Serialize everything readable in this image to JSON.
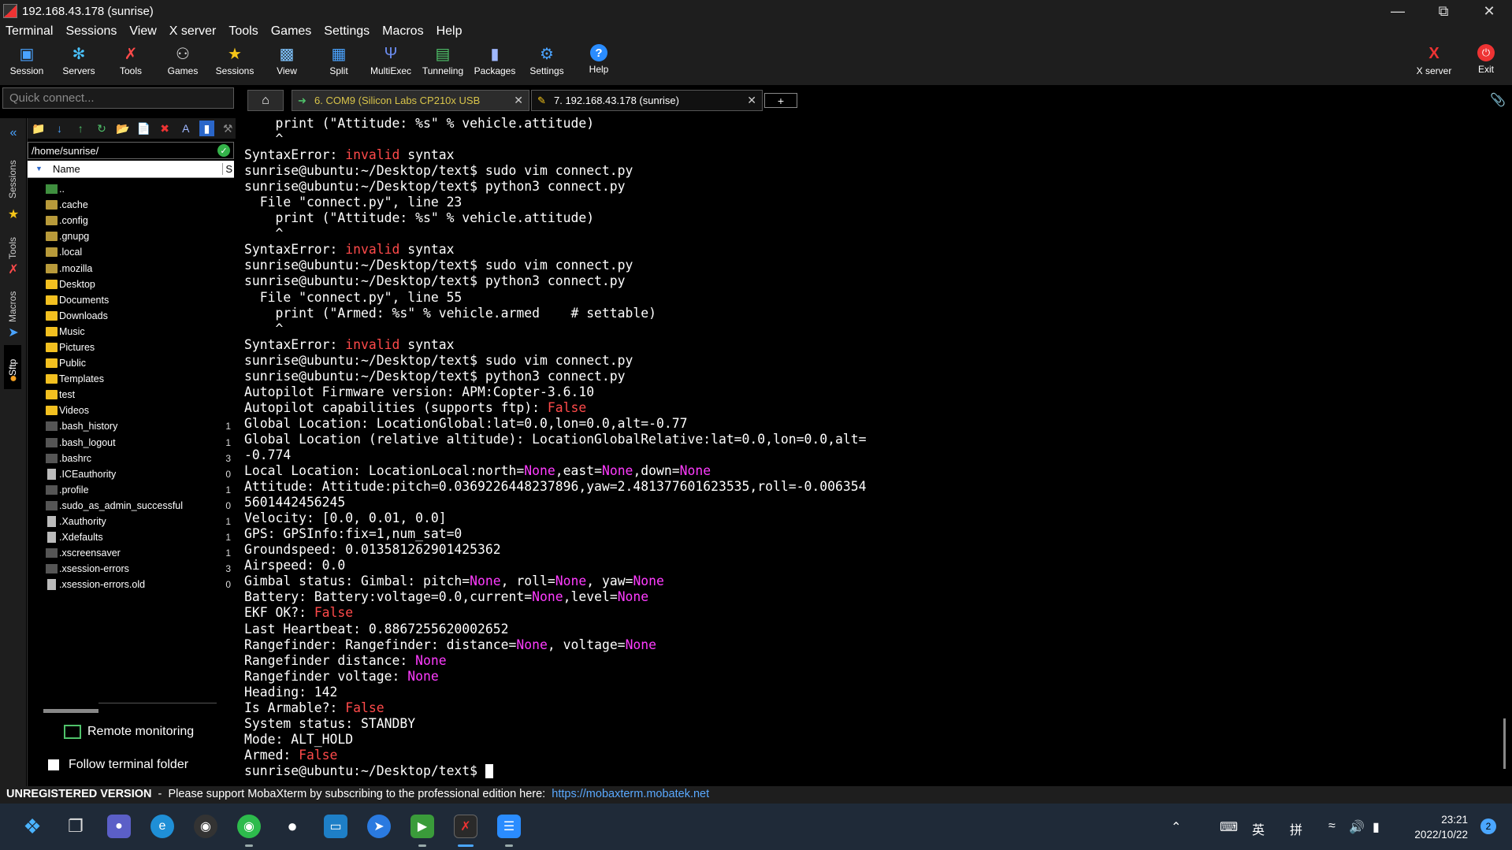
{
  "window": {
    "title": "192.168.43.178 (sunrise)"
  },
  "menu": [
    "Terminal",
    "Sessions",
    "View",
    "X server",
    "Tools",
    "Games",
    "Settings",
    "Macros",
    "Help"
  ],
  "toolbar": {
    "session": "Session",
    "servers": "Servers",
    "tools": "Tools",
    "games": "Games",
    "sessions": "Sessions",
    "view": "View",
    "split": "Split",
    "multiexec": "MultiExec",
    "tunneling": "Tunneling",
    "packages": "Packages",
    "settings": "Settings",
    "help": "Help",
    "xserver": "X server",
    "exit": "Exit"
  },
  "quick_connect": {
    "placeholder": "Quick connect..."
  },
  "tabs": [
    {
      "label": "6. COM9  (Silicon Labs CP210x USB"
    },
    {
      "label": "7. 192.168.43.178 (sunrise)"
    }
  ],
  "side_tabs": [
    "Sessions",
    "Tools",
    "Macros",
    "Sftp"
  ],
  "sftp": {
    "path": "/home/sunrise/",
    "column_name": "Name",
    "column_size": "S",
    "files": [
      {
        "name": "..",
        "type": "up",
        "size": ""
      },
      {
        "name": ".cache",
        "type": "folder-dim",
        "size": ""
      },
      {
        "name": ".config",
        "type": "folder-dim",
        "size": ""
      },
      {
        "name": ".gnupg",
        "type": "folder-dim",
        "size": ""
      },
      {
        "name": ".local",
        "type": "folder-dim",
        "size": ""
      },
      {
        "name": ".mozilla",
        "type": "folder-dim",
        "size": ""
      },
      {
        "name": "Desktop",
        "type": "folder",
        "size": ""
      },
      {
        "name": "Documents",
        "type": "folder",
        "size": ""
      },
      {
        "name": "Downloads",
        "type": "folder",
        "size": ""
      },
      {
        "name": "Music",
        "type": "folder",
        "size": ""
      },
      {
        "name": "Pictures",
        "type": "folder",
        "size": ""
      },
      {
        "name": "Public",
        "type": "folder",
        "size": ""
      },
      {
        "name": "Templates",
        "type": "folder",
        "size": ""
      },
      {
        "name": "test",
        "type": "folder",
        "size": ""
      },
      {
        "name": "Videos",
        "type": "folder",
        "size": ""
      },
      {
        "name": ".bash_history",
        "type": "file-dark",
        "size": "1"
      },
      {
        "name": ".bash_logout",
        "type": "file-dark",
        "size": "1"
      },
      {
        "name": ".bashrc",
        "type": "file-dark",
        "size": "3"
      },
      {
        "name": ".ICEauthority",
        "type": "file",
        "size": "0"
      },
      {
        "name": ".profile",
        "type": "file-dark",
        "size": "1"
      },
      {
        "name": ".sudo_as_admin_successful",
        "type": "file-dark",
        "size": "0"
      },
      {
        "name": ".Xauthority",
        "type": "file",
        "size": "1"
      },
      {
        "name": ".Xdefaults",
        "type": "file",
        "size": "1"
      },
      {
        "name": ".xscreensaver",
        "type": "file-dark",
        "size": "1"
      },
      {
        "name": ".xsession-errors",
        "type": "file-dark",
        "size": "3"
      },
      {
        "name": ".xsession-errors.old",
        "type": "file",
        "size": "0"
      }
    ],
    "remote_monitoring": "Remote monitoring",
    "follow_folder": "Follow terminal folder"
  },
  "terminal": {
    "lines": [
      [
        [
          "    print (\"Attitude: %s\" % vehicle.attitude)",
          ""
        ]
      ],
      [
        [
          "    ^",
          ""
        ]
      ],
      [
        [
          "SyntaxError: ",
          ""
        ],
        [
          "invalid",
          "red"
        ],
        [
          " syntax",
          ""
        ]
      ],
      [
        [
          "sunrise@ubuntu:~/Desktop/text$ sudo vim connect.py",
          ""
        ]
      ],
      [
        [
          "sunrise@ubuntu:~/Desktop/text$ python3 connect.py",
          ""
        ]
      ],
      [
        [
          "  File \"connect.py\", line 23",
          ""
        ]
      ],
      [
        [
          "    print (\"Attitude: %s\" % vehicle.attitude)",
          ""
        ]
      ],
      [
        [
          "    ^",
          ""
        ]
      ],
      [
        [
          "SyntaxError: ",
          ""
        ],
        [
          "invalid",
          "red"
        ],
        [
          " syntax",
          ""
        ]
      ],
      [
        [
          "sunrise@ubuntu:~/Desktop/text$ sudo vim connect.py",
          ""
        ]
      ],
      [
        [
          "sunrise@ubuntu:~/Desktop/text$ python3 connect.py",
          ""
        ]
      ],
      [
        [
          "  File \"connect.py\", line 55",
          ""
        ]
      ],
      [
        [
          "    print (\"Armed: %s\" % vehicle.armed    # settable)",
          ""
        ]
      ],
      [
        [
          "    ^",
          ""
        ]
      ],
      [
        [
          "SyntaxError: ",
          ""
        ],
        [
          "invalid",
          "red"
        ],
        [
          " syntax",
          ""
        ]
      ],
      [
        [
          "sunrise@ubuntu:~/Desktop/text$ sudo vim connect.py",
          ""
        ]
      ],
      [
        [
          "sunrise@ubuntu:~/Desktop/text$ python3 connect.py",
          ""
        ]
      ],
      [
        [
          "Autopilot Firmware version: APM:Copter-3.6.10",
          ""
        ]
      ],
      [
        [
          "Autopilot capabilities (supports ftp): ",
          ""
        ],
        [
          "False",
          "red"
        ]
      ],
      [
        [
          "Global Location: LocationGlobal:lat=0.0,lon=0.0,alt=-0.77",
          ""
        ]
      ],
      [
        [
          "Global Location (relative altitude): LocationGlobalRelative:lat=0.0,lon=0.0,alt=",
          ""
        ]
      ],
      [
        [
          "-0.774",
          ""
        ]
      ],
      [
        [
          "Local Location: LocationLocal:north=",
          ""
        ],
        [
          "None",
          "mag"
        ],
        [
          ",east=",
          ""
        ],
        [
          "None",
          "mag"
        ],
        [
          ",down=",
          ""
        ],
        [
          "None",
          "mag"
        ]
      ],
      [
        [
          "Attitude: Attitude:pitch=0.0369226448237896,yaw=2.481377601623535,roll=-0.006354",
          ""
        ]
      ],
      [
        [
          "5601442456245",
          ""
        ]
      ],
      [
        [
          "Velocity: [0.0, 0.01, 0.0]",
          ""
        ]
      ],
      [
        [
          "GPS: GPSInfo:fix=1,num_sat=0",
          ""
        ]
      ],
      [
        [
          "Groundspeed: 0.013581262901425362",
          ""
        ]
      ],
      [
        [
          "Airspeed: 0.0",
          ""
        ]
      ],
      [
        [
          "Gimbal status: Gimbal: pitch=",
          ""
        ],
        [
          "None",
          "mag"
        ],
        [
          ", roll=",
          ""
        ],
        [
          "None",
          "mag"
        ],
        [
          ", yaw=",
          ""
        ],
        [
          "None",
          "mag"
        ]
      ],
      [
        [
          "Battery: Battery:voltage=0.0,current=",
          ""
        ],
        [
          "None",
          "mag"
        ],
        [
          ",level=",
          ""
        ],
        [
          "None",
          "mag"
        ]
      ],
      [
        [
          "EKF OK?: ",
          ""
        ],
        [
          "False",
          "red"
        ]
      ],
      [
        [
          "Last Heartbeat: 0.8867255620002652",
          ""
        ]
      ],
      [
        [
          "Rangefinder: Rangefinder: distance=",
          ""
        ],
        [
          "None",
          "mag"
        ],
        [
          ", voltage=",
          ""
        ],
        [
          "None",
          "mag"
        ]
      ],
      [
        [
          "Rangefinder distance: ",
          ""
        ],
        [
          "None",
          "mag"
        ]
      ],
      [
        [
          "Rangefinder voltage: ",
          ""
        ],
        [
          "None",
          "mag"
        ]
      ],
      [
        [
          "Heading: 142",
          ""
        ]
      ],
      [
        [
          "Is Armable?: ",
          ""
        ],
        [
          "False",
          "red"
        ]
      ],
      [
        [
          "System status: STANDBY",
          ""
        ]
      ],
      [
        [
          "Mode: ALT_HOLD",
          ""
        ]
      ],
      [
        [
          "Armed: ",
          ""
        ],
        [
          "False",
          "red"
        ]
      ],
      [
        [
          "sunrise@ubuntu:~/Desktop/text$ ",
          ""
        ]
      ]
    ]
  },
  "status": {
    "unregistered": "UNREGISTERED VERSION",
    "message": "  -  Please support MobaXterm by subscribing to the professional edition here:  ",
    "link": "https://mobaxterm.mobatek.net"
  },
  "taskbar": {
    "ime_lang": "英",
    "ime_mode": "拼",
    "time": "23:21",
    "date": "2022/10/22",
    "notifications": "2"
  },
  "colors": {
    "error_red": "#ff4a4a",
    "none_magenta": "#ff3cff",
    "folder_yellow": "#f2c020"
  }
}
